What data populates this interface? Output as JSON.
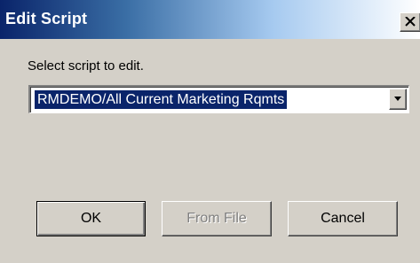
{
  "window": {
    "title": "Edit Script",
    "close_icon": "close-icon"
  },
  "form": {
    "prompt": "Select script to edit.",
    "script_select": {
      "selected": "RMDEMO/All Current Marketing Rqmts",
      "dropdown_icon": "chevron-down-icon"
    }
  },
  "buttons": {
    "ok": "OK",
    "from_file": "From File",
    "cancel": "Cancel"
  },
  "colors": {
    "titlebar_start": "#0a246a",
    "selection": "#0a246a",
    "dialog_face": "#d4d0c8",
    "disabled_text": "#808080"
  }
}
